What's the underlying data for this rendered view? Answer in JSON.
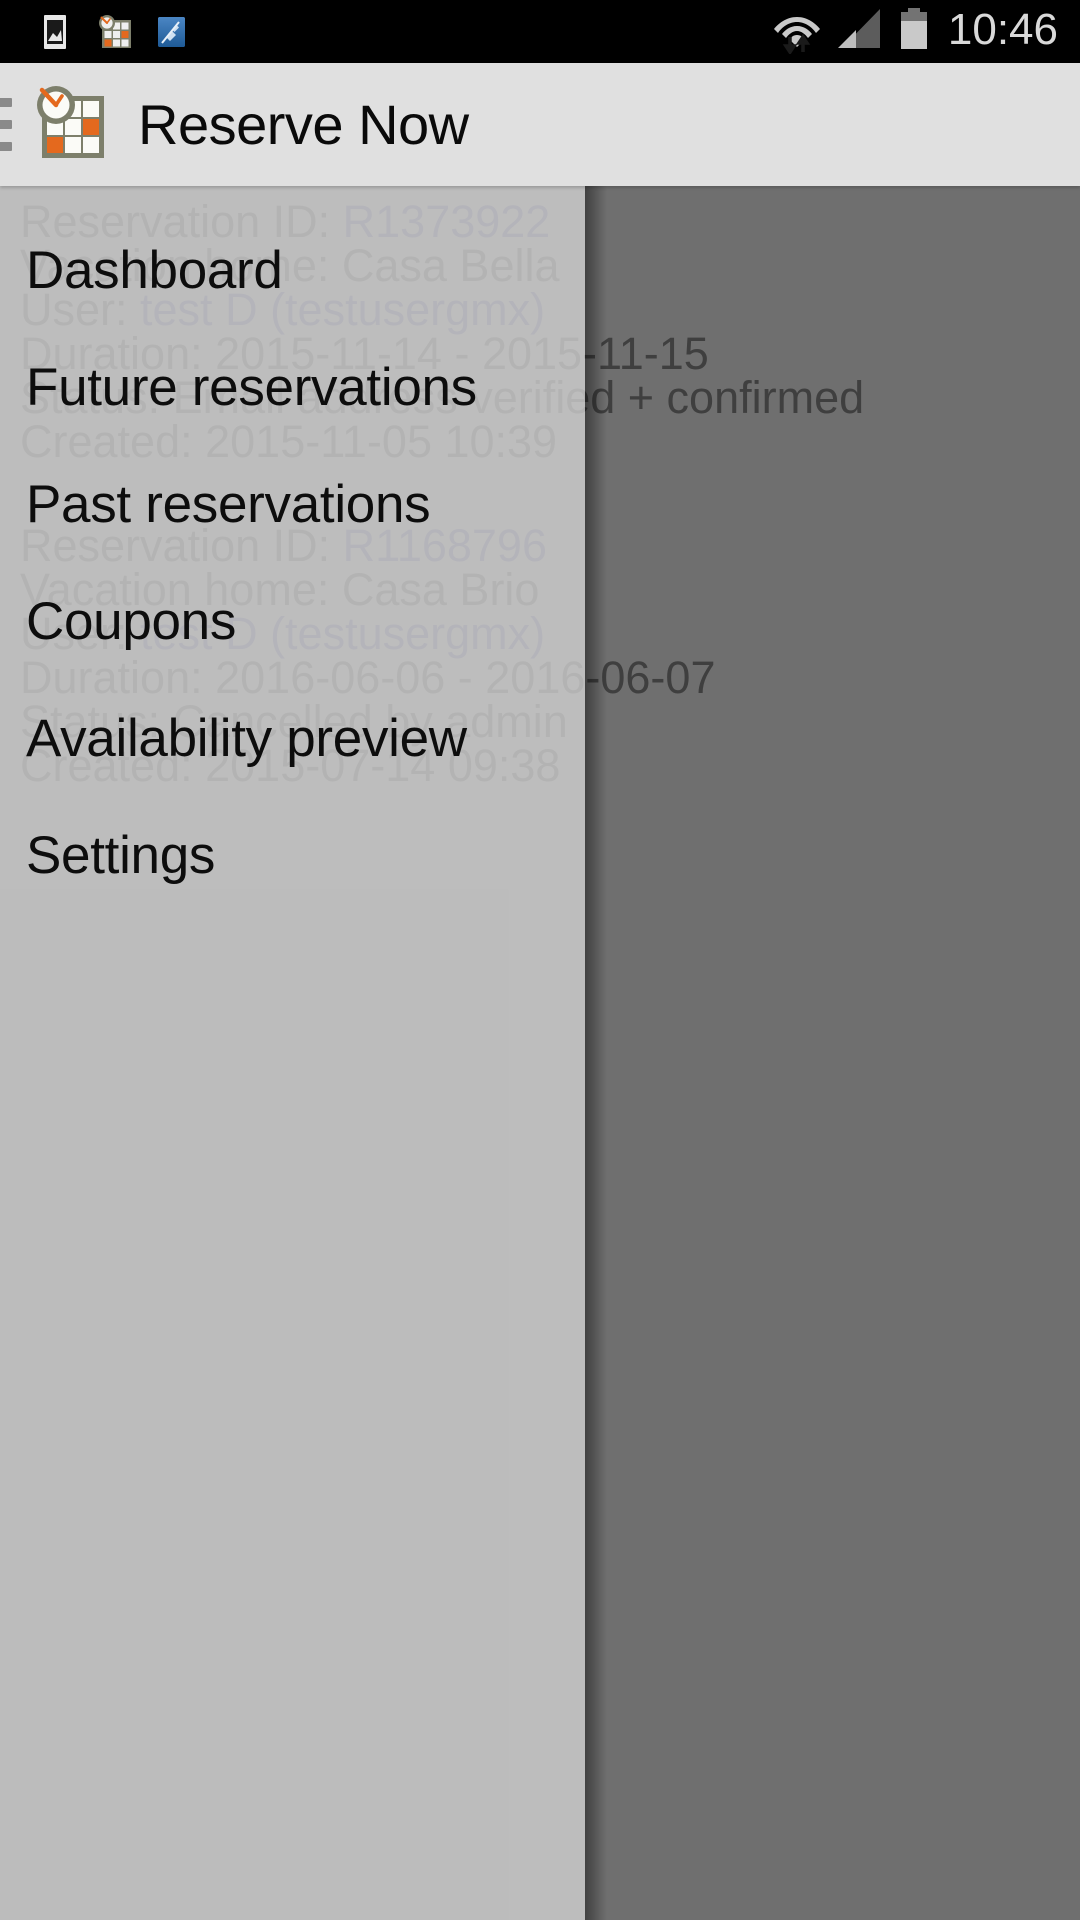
{
  "status_bar": {
    "time": "10:46",
    "notification_icons": [
      "photo-icon",
      "reserve-now-app-icon",
      "cleaner-app-icon"
    ],
    "system_icons": [
      "wifi-data-icon",
      "cellular-signal-icon",
      "battery-icon"
    ],
    "background_color": "#000000",
    "text_color": "#d9d9d9"
  },
  "app_bar": {
    "title": "Reserve Now",
    "menu_icon": "hamburger-menu-icon",
    "logo_icon": "reserve-now-logo-icon",
    "background_color": "#e0e0e0",
    "accent_color": "#e4691e"
  },
  "drawer": {
    "open": true,
    "items": [
      {
        "label": "Dashboard",
        "name": "dashboard"
      },
      {
        "label": "Future reservations",
        "name": "future-reservations"
      },
      {
        "label": "Past reservations",
        "name": "past-reservations"
      },
      {
        "label": "Coupons",
        "name": "coupons"
      },
      {
        "label": "Availability preview",
        "name": "availability-preview"
      },
      {
        "label": "Settings",
        "name": "settings"
      }
    ]
  },
  "content": {
    "reservations": [
      {
        "id_label": "Reservation ID:",
        "id_value": "R1373922",
        "home_label": "Vacation home:",
        "home_value": "Casa Bella",
        "user_label": "User:",
        "user_value": "test D (testusergmx)",
        "duration_label": "Duration:",
        "duration_value": "2015-11-14 - 2015-11-15",
        "status_label": "Status:",
        "status_value": "Email address verified + confirmed",
        "created_label": "Created:",
        "created_value": "2015-11-05 10:39"
      },
      {
        "id_label": "Reservation ID:",
        "id_value": "R1168796",
        "home_label": "Vacation home:",
        "home_value": "Casa Brio",
        "user_label": "User:",
        "user_value": "test D (testusergmx)",
        "duration_label": "Duration:",
        "duration_value": "2016-06-06 - 2016-06-07",
        "status_label": "Status:",
        "status_value": "Cancelled by admin",
        "created_label": "Created:",
        "created_value": "2015-07-14 09:38"
      }
    ]
  }
}
